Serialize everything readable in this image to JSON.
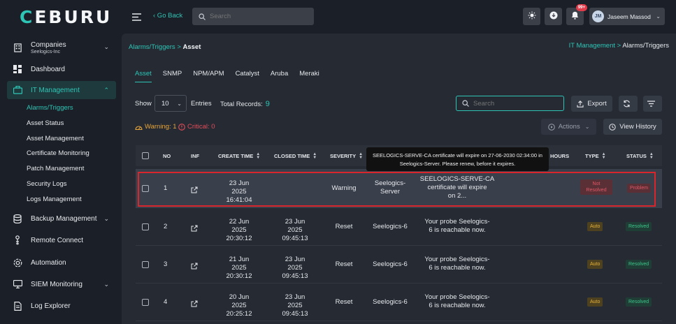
{
  "brand": {
    "name_first": "C",
    "name_rest": "EBURU"
  },
  "topbar": {
    "go_back": "‹ Go Back",
    "search_placeholder": "Search",
    "notification_badge": "99+",
    "user_initials": "JM",
    "user_name": "Jaseem Massod"
  },
  "sidebar": {
    "company_label": "Companies",
    "company_value": "Seelogics-Inc",
    "items": [
      {
        "label": "Dashboard",
        "icon": "dashboard-icon"
      },
      {
        "label": "IT Management",
        "icon": "briefcase-icon"
      },
      {
        "label": "Backup Management",
        "icon": "database-icon"
      },
      {
        "label": "Remote Connect",
        "icon": "remote-icon"
      },
      {
        "label": "Automation",
        "icon": "automation-icon"
      },
      {
        "label": "SIEM Monitoring",
        "icon": "monitor-icon"
      },
      {
        "label": "Log Explorer",
        "icon": "document-icon"
      }
    ],
    "sub_items": [
      "Alarms/Triggers",
      "Asset Status",
      "Asset Management",
      "Certificate Monitoring",
      "Patch Management",
      "Security Logs",
      "Logs Management"
    ]
  },
  "breadcrumb": {
    "left_link": "Alarms/Triggers >",
    "left_current": "Asset",
    "right_link": "IT Management >",
    "right_current": "Alarms/Triggers"
  },
  "tabs": [
    "Asset",
    "SNMP",
    "NPM/APM",
    "Catalyst",
    "Aruba",
    "Meraki"
  ],
  "toolbar": {
    "show_label": "Show",
    "show_value": "10",
    "entries_label": "Entries",
    "records_label": "Total Records:",
    "records_value": "9",
    "search_placeholder": "Search",
    "export_label": "Export",
    "actions_label": "Actions",
    "history_label": "View History",
    "warning_label": "Warning: 1",
    "critical_label": "Critical: 0"
  },
  "table": {
    "headers": [
      "NO",
      "INF",
      "CREATE TIME",
      "CLOSED TIME",
      "SEVERITY",
      "HOURS",
      "TYPE",
      "STATUS"
    ],
    "tooltip": "SEELOGICS-SERVE-CA certificate will expire on 27-06-2030 02:34:00 in Seelogics-Server. Please renew, before it expires.",
    "rows": [
      {
        "no": "1",
        "create_date": "23 Jun 2025",
        "create_time": "16:41:04",
        "closed_date": "",
        "closed_time": "",
        "severity": "Warning",
        "host_1": "Seelogics-",
        "host_2": "Server",
        "msg_1": "SEELOGICS-SERVE-CA",
        "msg_2": "certificate will expire",
        "msg_3": "on 2...",
        "type": "Not Resolved",
        "status": "Problem"
      },
      {
        "no": "2",
        "create_date": "22 Jun 2025",
        "create_time": "20:30:12",
        "closed_date": "23 Jun 2025",
        "closed_time": "09:45:13",
        "severity": "Reset",
        "host_1": "Seelogics-6",
        "host_2": "",
        "msg_1": "Your probe Seelogics-",
        "msg_2": "6 is reachable now.",
        "msg_3": "",
        "type": "Auto",
        "status": "Resolved"
      },
      {
        "no": "3",
        "create_date": "21 Jun 2025",
        "create_time": "20:30:12",
        "closed_date": "23 Jun 2025",
        "closed_time": "09:45:13",
        "severity": "Reset",
        "host_1": "Seelogics-6",
        "host_2": "",
        "msg_1": "Your probe Seelogics-",
        "msg_2": "6 is reachable now.",
        "msg_3": "",
        "type": "Auto",
        "status": "Resolved"
      },
      {
        "no": "4",
        "create_date": "20 Jun 2025",
        "create_time": "20:25:12",
        "closed_date": "23 Jun 2025",
        "closed_time": "09:45:13",
        "severity": "Reset",
        "host_1": "Seelogics-6",
        "host_2": "",
        "msg_1": "Your probe Seelogics-",
        "msg_2": "6 is reachable now.",
        "msg_3": "",
        "type": "Auto",
        "status": "Resolved"
      }
    ]
  },
  "colors": {
    "accent": "#2ec5b6",
    "warning": "#e8a53a",
    "critical": "#e54d5a",
    "highlight": "#d9262c"
  }
}
